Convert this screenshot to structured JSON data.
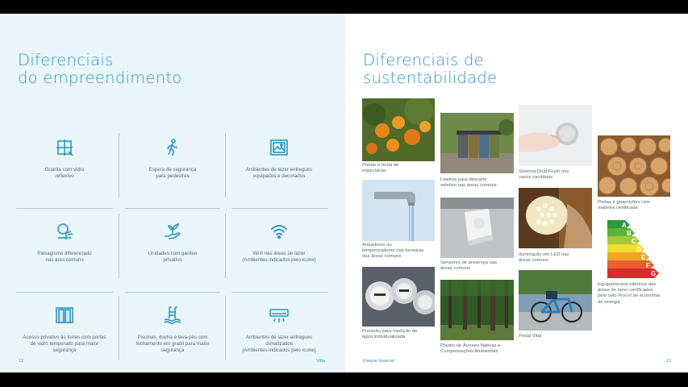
{
  "left_page": {
    "title_lines": [
      "Diferenciais",
      "do empreendimento"
    ],
    "features": [
      {
        "icon": "guardhouse-icon",
        "lines": [
          "Guarita com vidro",
          "reflexivo"
        ]
      },
      {
        "icon": "pedestrian-icon",
        "lines": [
          "Espera de segurança",
          "para pedestres"
        ]
      },
      {
        "icon": "picture-icon",
        "lines": [
          "Ambientes de lazer entregues",
          "equipados e decorados"
        ]
      },
      {
        "icon": "landscaping-icon",
        "lines": [
          "Paisagismo diferenciado",
          "nas áres comuns"
        ]
      },
      {
        "icon": "plant-hand-icon",
        "lines": [
          "Unidades com garden",
          "privativo"
        ]
      },
      {
        "icon": "wifi-icon",
        "lines": [
          "Wi-fi nas áreas de lazer",
          "(Ambientes indicados pelo ícone)"
        ]
      },
      {
        "icon": "door-icon",
        "lines": [
          "Acesso privativo às torres com portas",
          "de vidro temperado para maior",
          "segurança"
        ]
      },
      {
        "icon": "pool-icon",
        "lines": [
          "Piscinas, ducha e lava-pés com",
          "fechamento em gradil para maior",
          "segurança"
        ]
      },
      {
        "icon": "air-conditioner-icon",
        "lines": [
          "Ambientes de lazer entregues",
          "climatizados",
          "(Ambientes indicados pelo ícone)"
        ]
      }
    ],
    "page_number": "12",
    "footer_brand": "Vitta"
  },
  "right_page": {
    "title_lines": [
      "Diferenciais de",
      "sustentabilidade"
    ],
    "items": [
      {
        "name": "orchard",
        "caption": [
          "Pomar e horta de",
          "especiarias"
        ]
      },
      {
        "name": "recycling-bins",
        "caption": [
          "Lixeiras para descarte",
          "seletivo nas áreas comuns"
        ]
      },
      {
        "name": "dual-flush",
        "caption": [
          "Sistema Dual Flush nos",
          "vasos sanitários"
        ]
      },
      {
        "name": "wood-doors",
        "caption": [
          "Portas e guarnições com",
          "madeira certificada"
        ]
      },
      {
        "name": "aerators",
        "caption": [
          "Arejadores ou",
          "temporizadores nas torneiras",
          "das áreas comuns"
        ]
      },
      {
        "name": "presence-sensors",
        "caption": [
          "Sensores de presença nas",
          "áreas comuns"
        ]
      },
      {
        "name": "led-lighting",
        "caption": [
          "Iluminação em LED nas",
          "áreas comuns"
        ]
      },
      {
        "name": "energy-label",
        "caption": [
          "Equipamentos elétricos das",
          "áreas de lazer certificados",
          "pelo selo Procel de economia",
          "de energia"
        ],
        "energy_letters": [
          "A",
          "B",
          "C",
          "D",
          "E",
          "F",
          "G"
        ]
      },
      {
        "name": "water-meters",
        "caption": [
          "Previsão para medição de",
          "água individualizada"
        ]
      },
      {
        "name": "native-trees",
        "caption": [
          "Plantio de Árvores Nativas e",
          "Compensações Ambientais"
        ]
      },
      {
        "name": "bike-station",
        "caption": [
          "Pedal Vitta"
        ]
      }
    ],
    "page_number": "13",
    "footer_brand": "Parque Imperial"
  },
  "colors": {
    "accent": "#2b97c6",
    "text": "#5a6770",
    "left_bg": "#eaf6fb",
    "right_bg": "#ffffff"
  }
}
